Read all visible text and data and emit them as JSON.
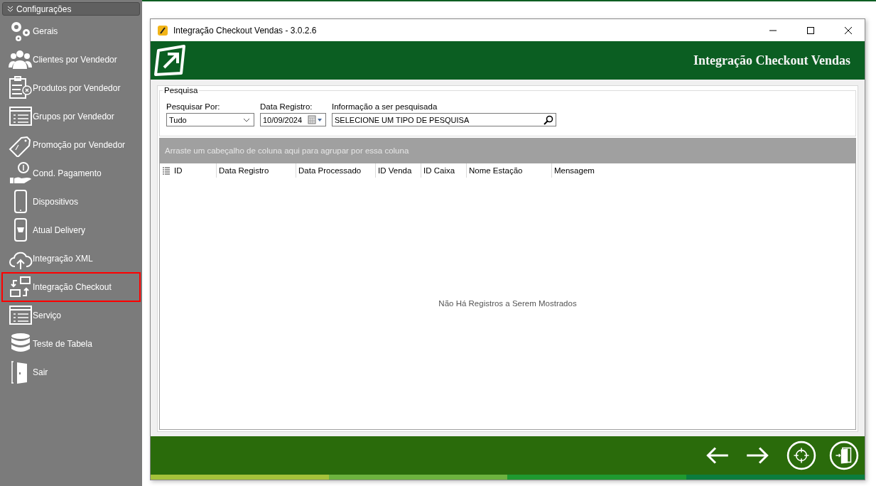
{
  "sidebar": {
    "header": "Configurações",
    "items": [
      {
        "label": "Gerais",
        "kind": "gears",
        "selected": false
      },
      {
        "label": "Clientes por Vendedor",
        "kind": "people",
        "selected": false
      },
      {
        "label": "Produtos por Vendedor",
        "kind": "clipboard",
        "selected": false
      },
      {
        "label": "Grupos por Vendedor",
        "kind": "list-window",
        "selected": false
      },
      {
        "label": "Promoção por Vendedor",
        "kind": "tag",
        "selected": false
      },
      {
        "label": "Cond. Pagamento",
        "kind": "coin-hand",
        "selected": false
      },
      {
        "label": "Dispositivos",
        "kind": "phone",
        "selected": false
      },
      {
        "label": "Atual Delivery",
        "kind": "phone-basket",
        "selected": false
      },
      {
        "label": "Integração XML",
        "kind": "cloud",
        "selected": false
      },
      {
        "label": "Integração Checkout",
        "kind": "swap",
        "selected": true
      },
      {
        "label": "Serviço",
        "kind": "list-window",
        "selected": false
      },
      {
        "label": "Teste de Tabela",
        "kind": "database",
        "selected": false
      },
      {
        "label": "Sair",
        "kind": "door",
        "selected": false
      }
    ]
  },
  "window": {
    "title": "Integração Checkout Vendas - 3.0.2.6",
    "banner_title": "Integração Checkout Vendas",
    "search": {
      "legend": "Pesquisa",
      "fields": [
        {
          "kind": "dropdown",
          "label": "Pesquisar Por:",
          "value": "Tudo"
        },
        {
          "kind": "date",
          "label": "Data Registro:",
          "value": "10/09/2024"
        },
        {
          "kind": "search",
          "label": "Informação a ser pesquisada",
          "value": "SELECIONE UM TIPO DE PESQUISA"
        }
      ]
    },
    "grid": {
      "group_panel": "Arraste um cabeçalho de coluna aqui para agrupar por essa coluna",
      "columns": [
        "ID",
        "Data Registro",
        "Data Processado",
        "ID Venda",
        "ID Caixa",
        "Nome Estação",
        "Mensagem"
      ],
      "empty_text": "Não Há Registros a Serem Mostrados"
    },
    "footer_buttons": [
      {
        "kind": "back"
      },
      {
        "kind": "forward"
      },
      {
        "kind": "target"
      },
      {
        "kind": "exit"
      }
    ]
  }
}
